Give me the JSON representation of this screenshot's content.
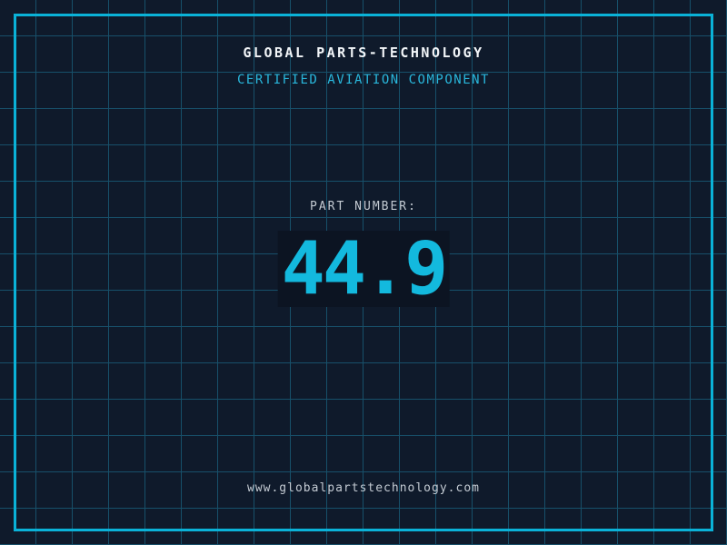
{
  "header": {
    "title": "GLOBAL PARTS-TECHNOLOGY",
    "subtitle": "CERTIFIED AVIATION COMPONENT"
  },
  "part": {
    "label": "PART NUMBER:",
    "value": "44.9"
  },
  "footer": {
    "url": "www.globalpartstechnology.com"
  },
  "colors": {
    "background": "#0f1a2b",
    "grid_line": "#17506a",
    "frame": "#0ab2d8",
    "accent_cyan": "#29b7dc",
    "number_cyan": "#13b9de",
    "text_light": "#c3cad2",
    "title_white": "#f2f5f8",
    "panel": "#0c1422"
  },
  "layout_meta": {
    "grid_spacing_px": "40"
  }
}
